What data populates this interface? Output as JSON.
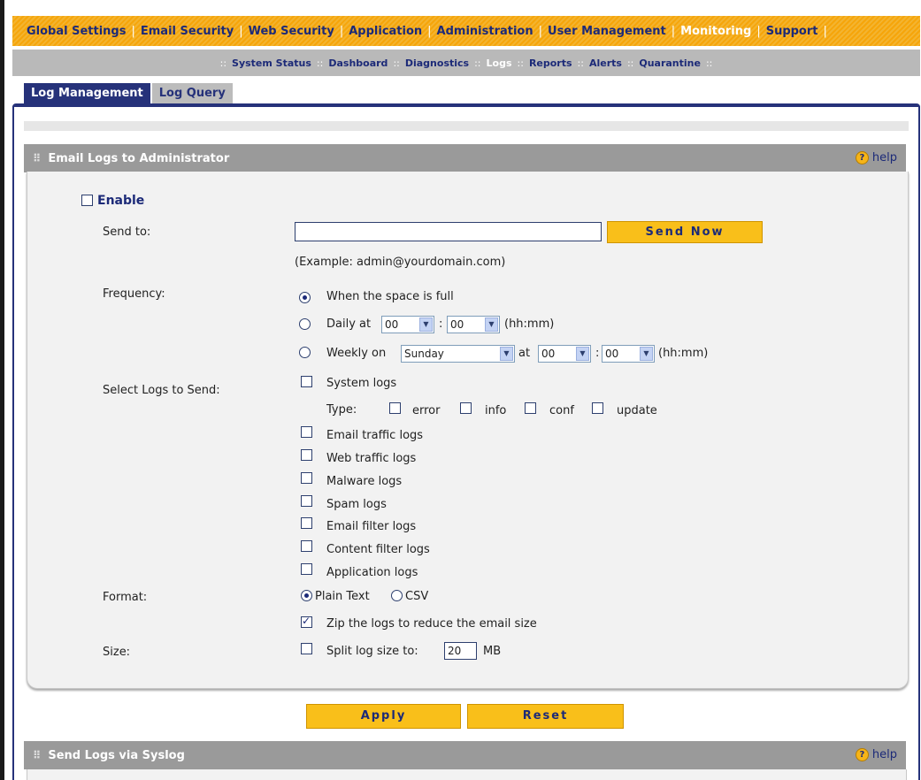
{
  "top_nav": [
    {
      "label": "Global Settings",
      "active": false
    },
    {
      "label": "Email Security",
      "active": false
    },
    {
      "label": "Web Security",
      "active": false
    },
    {
      "label": "Application",
      "active": false
    },
    {
      "label": "Administration",
      "active": false
    },
    {
      "label": "User Management",
      "active": false
    },
    {
      "label": "Monitoring",
      "active": true
    },
    {
      "label": "Support",
      "active": false
    }
  ],
  "sub_nav": [
    {
      "label": "System Status",
      "active": false
    },
    {
      "label": "Dashboard",
      "active": false
    },
    {
      "label": "Diagnostics",
      "active": false
    },
    {
      "label": "Logs",
      "active": true
    },
    {
      "label": "Reports",
      "active": false
    },
    {
      "label": "Alerts",
      "active": false
    },
    {
      "label": "Quarantine",
      "active": false
    }
  ],
  "tabs": {
    "log_management": "Log Management",
    "log_query": "Log Query"
  },
  "email_section": {
    "title": "Email Logs to Administrator",
    "help": "help",
    "enable_label": "Enable",
    "send_to_label": "Send to:",
    "send_to_value": "",
    "send_now": "Send Now",
    "example": "(Example: admin@yourdomain.com)",
    "frequency_label": "Frequency:",
    "freq_full": "When the space is full",
    "freq_daily": "Daily at",
    "freq_weekly": "Weekly on",
    "daily_hour": "00",
    "daily_min": "00",
    "weekly_day": "Sunday",
    "at": "at",
    "weekly_hour": "00",
    "weekly_min": "00",
    "colon": ":",
    "hhmm": "(hh:mm)",
    "select_logs_label": "Select Logs to Send:",
    "system_logs": "System logs",
    "type_label": "Type:",
    "types": [
      "error",
      "info",
      "conf",
      "update"
    ],
    "logs": [
      "Email traffic logs",
      "Web traffic logs",
      "Malware logs",
      "Spam logs",
      "Email filter logs",
      "Content filter logs",
      "Application logs"
    ],
    "format_label": "Format:",
    "format_plain": "Plain Text",
    "format_csv": "CSV",
    "zip_label": "Zip the logs to reduce the email size",
    "size_label": "Size:",
    "split_label": "Split log size to:",
    "split_value": "20",
    "split_unit": "MB"
  },
  "buttons": {
    "apply": "Apply",
    "reset": "Reset"
  },
  "syslog_section": {
    "title": "Send Logs via Syslog",
    "help": "help"
  }
}
